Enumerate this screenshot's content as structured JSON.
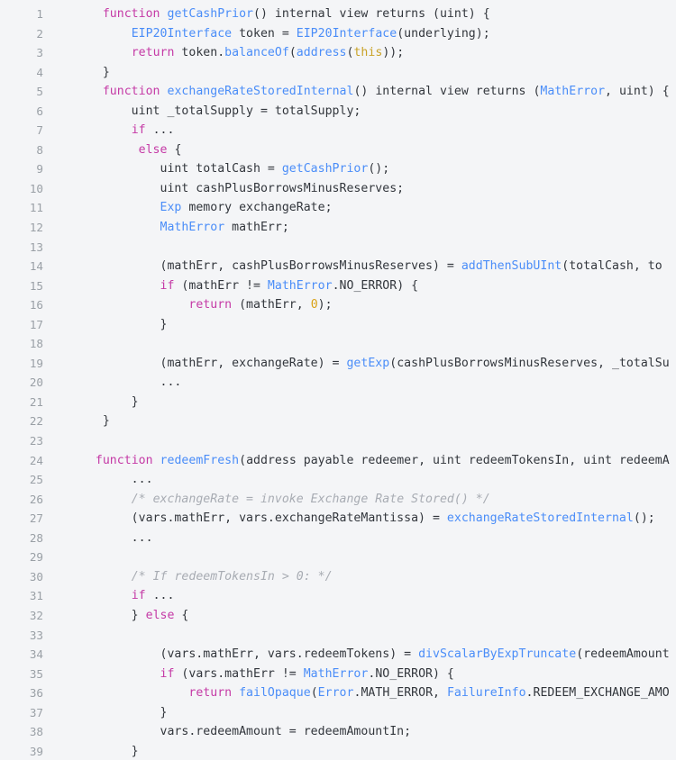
{
  "viewer": {
    "name": "code-snippet-viewer",
    "language": "solidity",
    "background_color": "#f4f5f7",
    "text_color": "#32363c",
    "gutter_color": "#9aa0a6",
    "keyword_color": "#c53aa6",
    "function_color": "#4a8df8",
    "type_color": "#4a8df8",
    "number_color": "#d9a115",
    "builtin_color": "#c9a227",
    "comment_color": "#a8acb3",
    "first_line_number": 1,
    "last_line_number": 39,
    "total_visible_lines": 39
  },
  "lines": [
    {
      "n": "1",
      "tokens": [
        {
          "t": "    ",
          "c": "plain"
        },
        {
          "t": "function",
          "c": "kw"
        },
        {
          "t": " ",
          "c": "plain"
        },
        {
          "t": "getCashPrior",
          "c": "fn"
        },
        {
          "t": "() internal view returns (uint) {",
          "c": "plain"
        }
      ]
    },
    {
      "n": "2",
      "tokens": [
        {
          "t": "        ",
          "c": "plain"
        },
        {
          "t": "EIP20Interface",
          "c": "type"
        },
        {
          "t": " token = ",
          "c": "plain"
        },
        {
          "t": "EIP20Interface",
          "c": "type"
        },
        {
          "t": "(underlying);",
          "c": "plain"
        }
      ]
    },
    {
      "n": "3",
      "tokens": [
        {
          "t": "        ",
          "c": "plain"
        },
        {
          "t": "return",
          "c": "kw"
        },
        {
          "t": " token.",
          "c": "plain"
        },
        {
          "t": "balanceOf",
          "c": "fn"
        },
        {
          "t": "(",
          "c": "plain"
        },
        {
          "t": "address",
          "c": "fn"
        },
        {
          "t": "(",
          "c": "plain"
        },
        {
          "t": "this",
          "c": "builtin"
        },
        {
          "t": "));",
          "c": "plain"
        }
      ]
    },
    {
      "n": "4",
      "tokens": [
        {
          "t": "    }",
          "c": "plain"
        }
      ]
    },
    {
      "n": "5",
      "tokens": [
        {
          "t": "    ",
          "c": "plain"
        },
        {
          "t": "function",
          "c": "kw"
        },
        {
          "t": " ",
          "c": "plain"
        },
        {
          "t": "exchangeRateStoredInternal",
          "c": "fn"
        },
        {
          "t": "() internal view returns (",
          "c": "plain"
        },
        {
          "t": "MathError",
          "c": "type"
        },
        {
          "t": ", uint) {",
          "c": "plain"
        }
      ]
    },
    {
      "n": "6",
      "tokens": [
        {
          "t": "        uint _totalSupply = totalSupply;",
          "c": "plain"
        }
      ]
    },
    {
      "n": "7",
      "tokens": [
        {
          "t": "        ",
          "c": "plain"
        },
        {
          "t": "if",
          "c": "kw"
        },
        {
          "t": " ...",
          "c": "plain"
        }
      ]
    },
    {
      "n": "8",
      "tokens": [
        {
          "t": "         ",
          "c": "plain"
        },
        {
          "t": "else",
          "c": "kw"
        },
        {
          "t": " {",
          "c": "plain"
        }
      ]
    },
    {
      "n": "9",
      "tokens": [
        {
          "t": "            uint totalCash = ",
          "c": "plain"
        },
        {
          "t": "getCashPrior",
          "c": "fn"
        },
        {
          "t": "();",
          "c": "plain"
        }
      ]
    },
    {
      "n": "10",
      "tokens": [
        {
          "t": "            uint cashPlusBorrowsMinusReserves;",
          "c": "plain"
        }
      ]
    },
    {
      "n": "11",
      "tokens": [
        {
          "t": "            ",
          "c": "plain"
        },
        {
          "t": "Exp",
          "c": "type"
        },
        {
          "t": " memory exchangeRate;",
          "c": "plain"
        }
      ]
    },
    {
      "n": "12",
      "tokens": [
        {
          "t": "            ",
          "c": "plain"
        },
        {
          "t": "MathError",
          "c": "type"
        },
        {
          "t": " mathErr;",
          "c": "plain"
        }
      ]
    },
    {
      "n": "13",
      "tokens": [
        {
          "t": "",
          "c": "plain"
        }
      ]
    },
    {
      "n": "14",
      "tokens": [
        {
          "t": "            (mathErr, cashPlusBorrowsMinusReserves) = ",
          "c": "plain"
        },
        {
          "t": "addThenSubUInt",
          "c": "fn"
        },
        {
          "t": "(totalCash, to",
          "c": "plain"
        }
      ]
    },
    {
      "n": "15",
      "tokens": [
        {
          "t": "            ",
          "c": "plain"
        },
        {
          "t": "if",
          "c": "kw"
        },
        {
          "t": " (mathErr != ",
          "c": "plain"
        },
        {
          "t": "MathError",
          "c": "type"
        },
        {
          "t": ".NO_ERROR) {",
          "c": "plain"
        }
      ]
    },
    {
      "n": "16",
      "tokens": [
        {
          "t": "                ",
          "c": "plain"
        },
        {
          "t": "return",
          "c": "kw"
        },
        {
          "t": " (mathErr, ",
          "c": "plain"
        },
        {
          "t": "0",
          "c": "num"
        },
        {
          "t": ");",
          "c": "plain"
        }
      ]
    },
    {
      "n": "17",
      "tokens": [
        {
          "t": "            }",
          "c": "plain"
        }
      ]
    },
    {
      "n": "18",
      "tokens": [
        {
          "t": "",
          "c": "plain"
        }
      ]
    },
    {
      "n": "19",
      "tokens": [
        {
          "t": "            (mathErr, exchangeRate) = ",
          "c": "plain"
        },
        {
          "t": "getExp",
          "c": "fn"
        },
        {
          "t": "(cashPlusBorrowsMinusReserves, _totalSu",
          "c": "plain"
        }
      ]
    },
    {
      "n": "20",
      "tokens": [
        {
          "t": "            ...",
          "c": "plain"
        }
      ]
    },
    {
      "n": "21",
      "tokens": [
        {
          "t": "        }",
          "c": "plain"
        }
      ]
    },
    {
      "n": "22",
      "tokens": [
        {
          "t": "    }",
          "c": "plain"
        }
      ]
    },
    {
      "n": "23",
      "tokens": [
        {
          "t": "",
          "c": "plain"
        }
      ]
    },
    {
      "n": "24",
      "tokens": [
        {
          "t": "   ",
          "c": "plain"
        },
        {
          "t": "function",
          "c": "kw"
        },
        {
          "t": " ",
          "c": "plain"
        },
        {
          "t": "redeemFresh",
          "c": "fn"
        },
        {
          "t": "(address payable redeemer, uint redeemTokensIn, uint redeemA",
          "c": "plain"
        }
      ]
    },
    {
      "n": "25",
      "tokens": [
        {
          "t": "        ...",
          "c": "plain"
        }
      ]
    },
    {
      "n": "26",
      "tokens": [
        {
          "t": "        ",
          "c": "plain"
        },
        {
          "t": "/* exchangeRate = invoke Exchange Rate Stored() */",
          "c": "comment"
        }
      ]
    },
    {
      "n": "27",
      "tokens": [
        {
          "t": "        (vars.mathErr, vars.exchangeRateMantissa) = ",
          "c": "plain"
        },
        {
          "t": "exchangeRateStoredInternal",
          "c": "fn"
        },
        {
          "t": "();",
          "c": "plain"
        }
      ]
    },
    {
      "n": "28",
      "tokens": [
        {
          "t": "        ...",
          "c": "plain"
        }
      ]
    },
    {
      "n": "29",
      "tokens": [
        {
          "t": "",
          "c": "plain"
        }
      ]
    },
    {
      "n": "30",
      "tokens": [
        {
          "t": "        ",
          "c": "plain"
        },
        {
          "t": "/* If redeemTokensIn > 0: */",
          "c": "comment"
        }
      ]
    },
    {
      "n": "31",
      "tokens": [
        {
          "t": "        ",
          "c": "plain"
        },
        {
          "t": "if",
          "c": "kw"
        },
        {
          "t": " ...",
          "c": "plain"
        }
      ]
    },
    {
      "n": "32",
      "tokens": [
        {
          "t": "        } ",
          "c": "plain"
        },
        {
          "t": "else",
          "c": "kw"
        },
        {
          "t": " {",
          "c": "plain"
        }
      ]
    },
    {
      "n": "33",
      "tokens": [
        {
          "t": "",
          "c": "plain"
        }
      ]
    },
    {
      "n": "34",
      "tokens": [
        {
          "t": "            (vars.mathErr, vars.redeemTokens) = ",
          "c": "plain"
        },
        {
          "t": "divScalarByExpTruncate",
          "c": "fn"
        },
        {
          "t": "(redeemAmount",
          "c": "plain"
        }
      ]
    },
    {
      "n": "35",
      "tokens": [
        {
          "t": "            ",
          "c": "plain"
        },
        {
          "t": "if",
          "c": "kw"
        },
        {
          "t": " (vars.mathErr != ",
          "c": "plain"
        },
        {
          "t": "MathError",
          "c": "type"
        },
        {
          "t": ".NO_ERROR) {",
          "c": "plain"
        }
      ]
    },
    {
      "n": "36",
      "tokens": [
        {
          "t": "                ",
          "c": "plain"
        },
        {
          "t": "return",
          "c": "kw"
        },
        {
          "t": " ",
          "c": "plain"
        },
        {
          "t": "failOpaque",
          "c": "fn"
        },
        {
          "t": "(",
          "c": "plain"
        },
        {
          "t": "Error",
          "c": "type"
        },
        {
          "t": ".MATH_ERROR, ",
          "c": "plain"
        },
        {
          "t": "FailureInfo",
          "c": "type"
        },
        {
          "t": ".REDEEM_EXCHANGE_AMO",
          "c": "plain"
        }
      ]
    },
    {
      "n": "37",
      "tokens": [
        {
          "t": "            }",
          "c": "plain"
        }
      ]
    },
    {
      "n": "38",
      "tokens": [
        {
          "t": "            vars.redeemAmount = redeemAmountIn;",
          "c": "plain"
        }
      ]
    },
    {
      "n": "39",
      "tokens": [
        {
          "t": "        }",
          "c": "plain"
        }
      ]
    }
  ]
}
